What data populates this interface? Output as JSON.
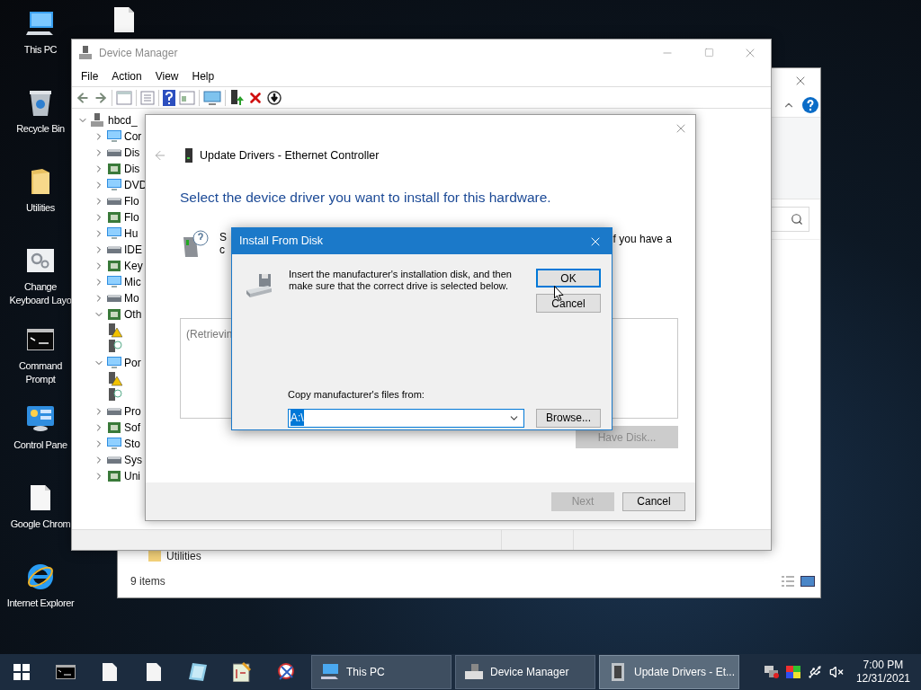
{
  "desktop_icons": [
    {
      "kind": "pc",
      "lines": [
        "This PC"
      ]
    },
    {
      "kind": "recycle",
      "lines": [
        "Recycle Bin"
      ]
    },
    {
      "kind": "folder",
      "lines": [
        "Utilities"
      ]
    },
    {
      "kind": "settings",
      "lines": [
        "Change",
        "Keyboard Layo"
      ]
    },
    {
      "kind": "cmd",
      "lines": [
        "Command",
        "Prompt"
      ]
    },
    {
      "kind": "control",
      "lines": [
        "Control Pane"
      ]
    },
    {
      "kind": "file",
      "lines": [
        "Google Chrom"
      ]
    },
    {
      "kind": "ie",
      "lines": [
        "Internet Explorer"
      ]
    }
  ],
  "explorer": {
    "items": [
      {
        "label": "Utilities"
      }
    ],
    "status": "9 items"
  },
  "device_manager": {
    "title": "Device Manager",
    "active": false,
    "menu": [
      "File",
      "Action",
      "View",
      "Help"
    ],
    "tree": {
      "label": "hbcd_",
      "expanded": true,
      "children": [
        {
          "label": "Cor",
          "expanded": false
        },
        {
          "label": "Dis",
          "expanded": false
        },
        {
          "label": "Dis",
          "expanded": false
        },
        {
          "label": "DVD",
          "expanded": false
        },
        {
          "label": "Flo",
          "expanded": false
        },
        {
          "label": "Flo",
          "expanded": false
        },
        {
          "label": "Hu",
          "expanded": false
        },
        {
          "label": "IDE",
          "expanded": false
        },
        {
          "label": "Key",
          "expanded": false
        },
        {
          "label": "Mic",
          "expanded": false
        },
        {
          "label": "Mo",
          "expanded": false
        },
        {
          "label": "Oth",
          "expanded": true,
          "children": [
            {
              "warning": true
            },
            {
              "warning": false
            }
          ]
        },
        {
          "label": "Por",
          "expanded": true,
          "children": [
            {
              "warning": true
            },
            {
              "warning": false
            }
          ]
        },
        {
          "label": "Pro",
          "expanded": false
        },
        {
          "label": "Sof",
          "expanded": false
        },
        {
          "label": "Sto",
          "expanded": false
        },
        {
          "label": "Sys",
          "expanded": false
        },
        {
          "label": "Uni",
          "expanded": false
        }
      ]
    }
  },
  "update_drivers": {
    "title": "Update Drivers - Ethernet Controller",
    "heading": "Select the device driver you want to install for this hardware.",
    "text_left": [
      "S",
      "c"
    ],
    "text_right": "f you have a",
    "list_text": "(Retrievin",
    "have_disk": {
      "label": "Have Disk...",
      "disabled": true
    },
    "buttons": [
      {
        "label": "Next",
        "disabled": true
      },
      {
        "label": "Cancel",
        "disabled": false
      }
    ]
  },
  "install_from_disk": {
    "title": "Install From Disk",
    "message_lines": [
      "Insert the manufacturer's installation disk, and then",
      "make sure that the correct drive is selected below."
    ],
    "ok": {
      "label": "OK",
      "default": true
    },
    "cancel": {
      "label": "Cancel",
      "default": false
    },
    "copy_label": "Copy manufacturer's files from:",
    "path": {
      "value": "A:\\",
      "selected": true
    },
    "browse": "Browse..."
  },
  "taskbar": {
    "tasks": [
      {
        "label": "This PC",
        "active": false
      },
      {
        "label": "Device Manager",
        "active": false
      },
      {
        "label": "Update Drivers - Et...",
        "active": true
      }
    ],
    "time": "7:00 PM",
    "date": "12/31/2021"
  }
}
